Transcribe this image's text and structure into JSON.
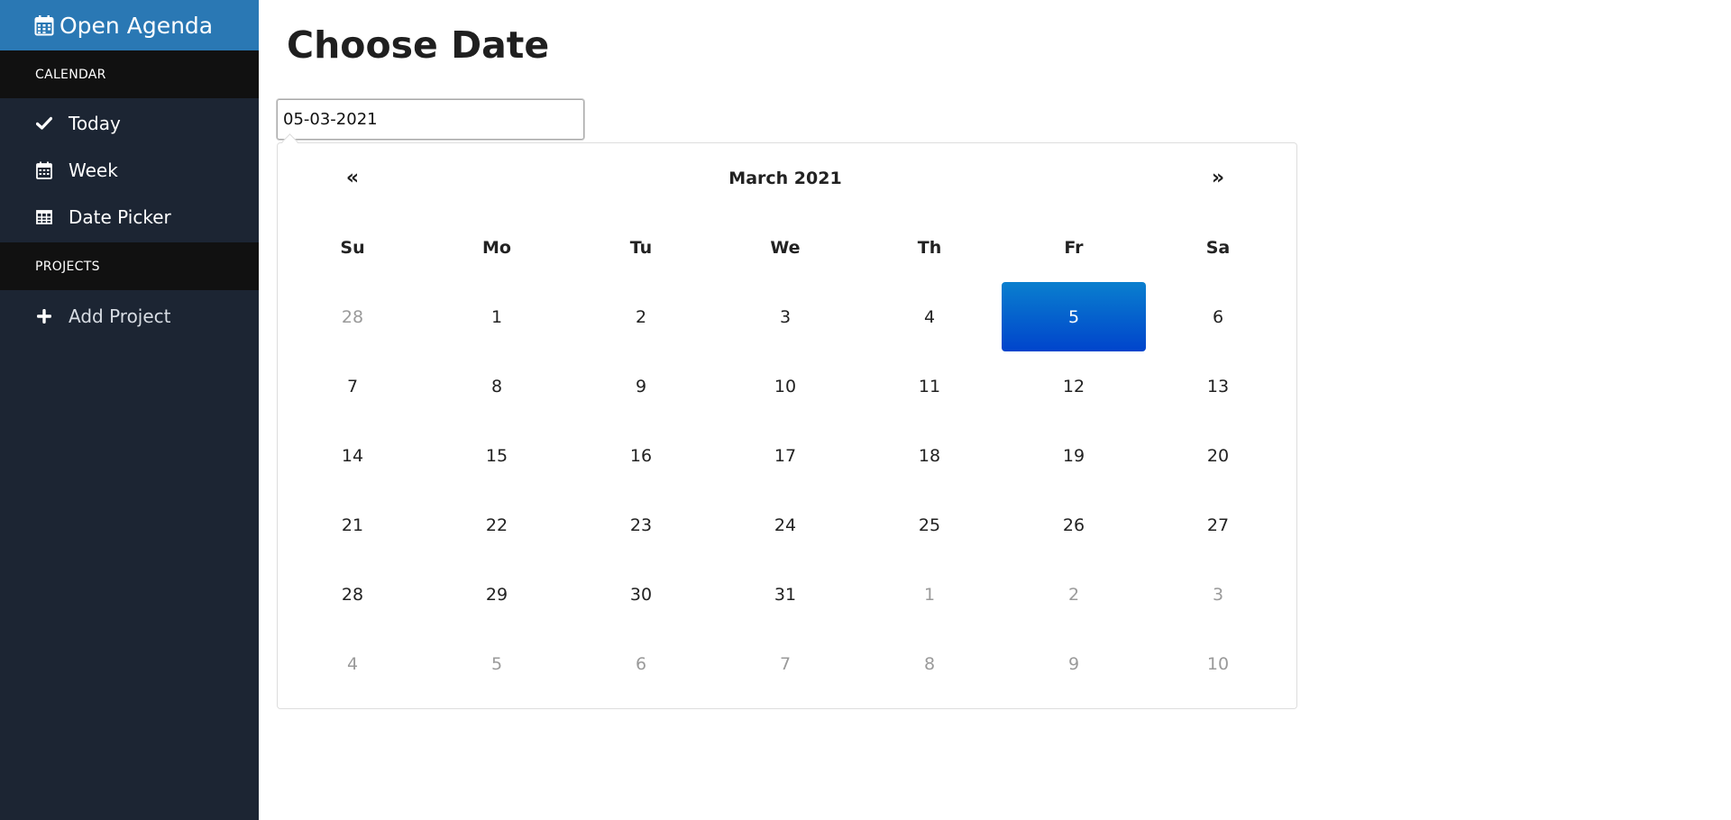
{
  "brand": {
    "title": "Open Agenda",
    "icon": "calendar-icon"
  },
  "sidebar": {
    "sections": [
      {
        "header": "CALENDAR",
        "items": [
          {
            "label": "Today",
            "icon": "check-icon"
          },
          {
            "label": "Week",
            "icon": "calendar-icon"
          },
          {
            "label": "Date Picker",
            "icon": "table-icon"
          }
        ]
      },
      {
        "header": "PROJECTS",
        "items": [
          {
            "label": "Add Project",
            "icon": "plus-icon"
          }
        ]
      }
    ]
  },
  "main": {
    "title": "Choose Date",
    "date_input": {
      "value": "05-03-2021"
    }
  },
  "datepicker": {
    "prev_label": "«",
    "next_label": "»",
    "month_label": "March 2021",
    "weekdays": [
      "Su",
      "Mo",
      "Tu",
      "We",
      "Th",
      "Fr",
      "Sa"
    ],
    "weeks": [
      [
        "28",
        "1",
        "2",
        "3",
        "4",
        "5",
        "6"
      ],
      [
        "7",
        "8",
        "9",
        "10",
        "11",
        "12",
        "13"
      ],
      [
        "14",
        "15",
        "16",
        "17",
        "18",
        "19",
        "20"
      ],
      [
        "21",
        "22",
        "23",
        "24",
        "25",
        "26",
        "27"
      ],
      [
        "28",
        "29",
        "30",
        "31",
        "1",
        "2",
        "3"
      ],
      [
        "4",
        "5",
        "6",
        "7",
        "8",
        "9",
        "10"
      ]
    ],
    "muted_days": [
      "w0d0",
      "w4d4",
      "w4d5",
      "w4d6",
      "w5d0",
      "w5d1",
      "w5d2",
      "w5d3",
      "w5d4",
      "w5d5",
      "w5d6"
    ],
    "selected_day": "w0d5",
    "colors": {
      "selected_top": "#0a7fce",
      "selected_bottom": "#0044cc",
      "muted_text": "#9a9a9a"
    }
  },
  "colors": {
    "brand_bg": "#2a78b4",
    "sidebar_bg": "#1c2533",
    "section_header_bg": "#111111"
  }
}
